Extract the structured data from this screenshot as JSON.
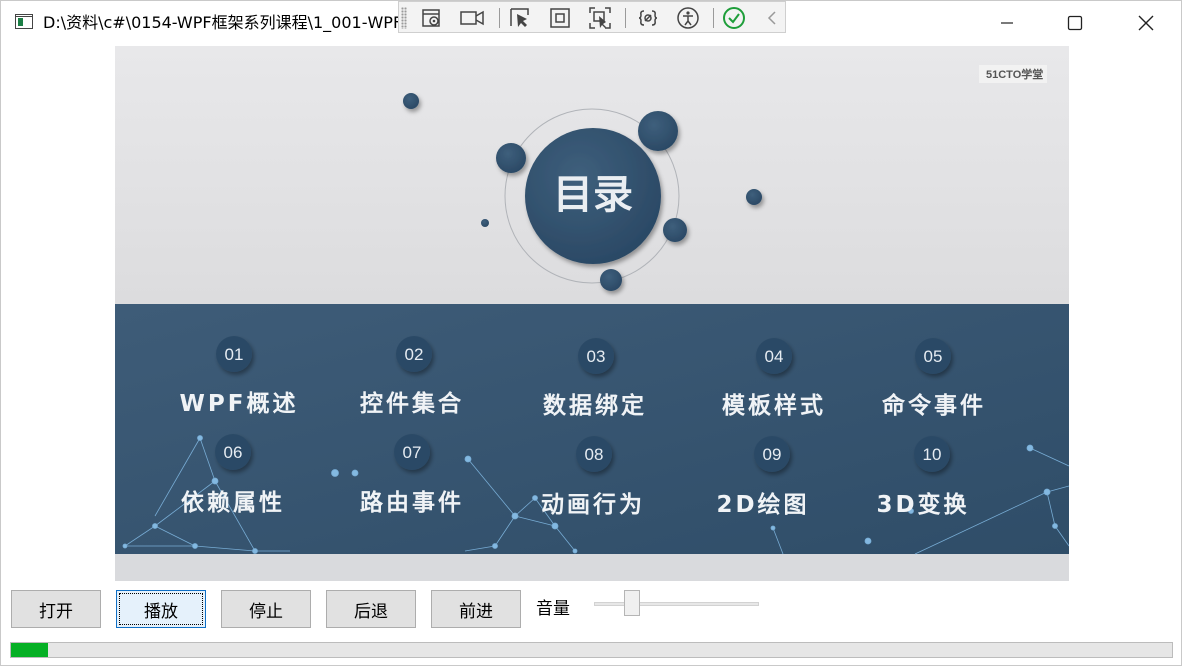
{
  "window": {
    "title": "D:\\资料\\c#\\0154-WPF框架系列课程\\1_001-WPF框架系列课程-目录.mp4"
  },
  "debug_toolbar": {
    "icons": [
      "select-element-icon",
      "live-video-icon",
      "pointer-icon",
      "bounds-icon",
      "track-focus-icon",
      "binding-failures-icon",
      "accessibility-icon",
      "check-icon",
      "collapse-icon"
    ]
  },
  "slide": {
    "watermark": "51CTO学堂",
    "heading": "目录",
    "items": [
      {
        "num": "01",
        "label": "WPF概述"
      },
      {
        "num": "02",
        "label": "控件集合"
      },
      {
        "num": "03",
        "label": "数据绑定"
      },
      {
        "num": "04",
        "label": "模板样式"
      },
      {
        "num": "05",
        "label": "命令事件"
      },
      {
        "num": "06",
        "label": "依赖属性"
      },
      {
        "num": "07",
        "label": "路由事件"
      },
      {
        "num": "08",
        "label": "动画行为"
      },
      {
        "num": "09",
        "label": "2D绘图"
      },
      {
        "num": "10",
        "label": "3D变换"
      }
    ],
    "colors": {
      "panel": "#3a5873",
      "bubble": "#2e4d68",
      "background": "#e6e7e9"
    }
  },
  "controls": {
    "open": "打开",
    "play": "播放",
    "stop": "停止",
    "back": "后退",
    "forward": "前进",
    "volume_label": "音量",
    "volume_level": 0.2
  },
  "playback": {
    "progress": 0.032,
    "progress_color": "#06b025"
  }
}
